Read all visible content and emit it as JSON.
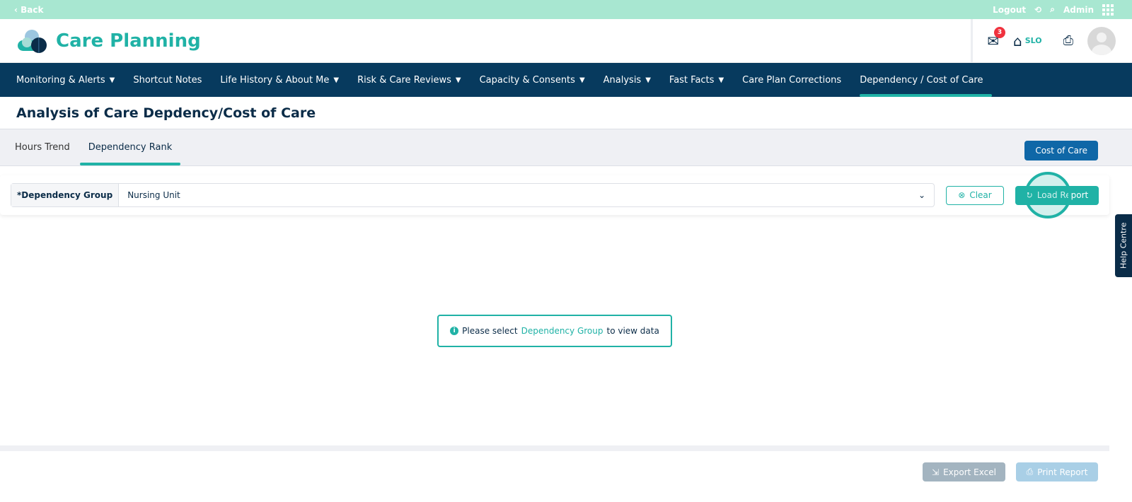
{
  "topbar": {
    "back": "‹ Back",
    "logout": "Logout",
    "admin": "Admin"
  },
  "header": {
    "app_title": "Care Planning",
    "mail_count": "3",
    "home_label": "SLO"
  },
  "nav": [
    {
      "label": "Monitoring & Alerts",
      "dropdown": true
    },
    {
      "label": "Shortcut Notes",
      "dropdown": false
    },
    {
      "label": "Life History & About Me",
      "dropdown": true
    },
    {
      "label": "Risk & Care Reviews",
      "dropdown": true
    },
    {
      "label": "Capacity & Consents",
      "dropdown": true
    },
    {
      "label": "Analysis",
      "dropdown": true
    },
    {
      "label": "Fast Facts",
      "dropdown": true
    },
    {
      "label": "Care Plan Corrections",
      "dropdown": false
    },
    {
      "label": "Dependency / Cost of Care",
      "dropdown": false,
      "active": true
    }
  ],
  "page_title": "Analysis of Care Depdency/Cost of Care",
  "tabs": [
    {
      "label": "Hours Trend"
    },
    {
      "label": "Dependency Rank",
      "active": true
    }
  ],
  "cost_button": "Cost of Care",
  "filter": {
    "label": "*Dependency Group",
    "value": "Nursing Unit",
    "clear": "Clear",
    "load": "Load Report"
  },
  "help": "Help Centre",
  "message": {
    "pre": "Please select",
    "link": "Dependency Group",
    "post": "to view data"
  },
  "footer": {
    "export": "Export Excel",
    "print": "Print Report"
  },
  "colors": {
    "accent": "#20b2a6",
    "nav": "#073a5e",
    "topbar": "#a8e7d1"
  }
}
